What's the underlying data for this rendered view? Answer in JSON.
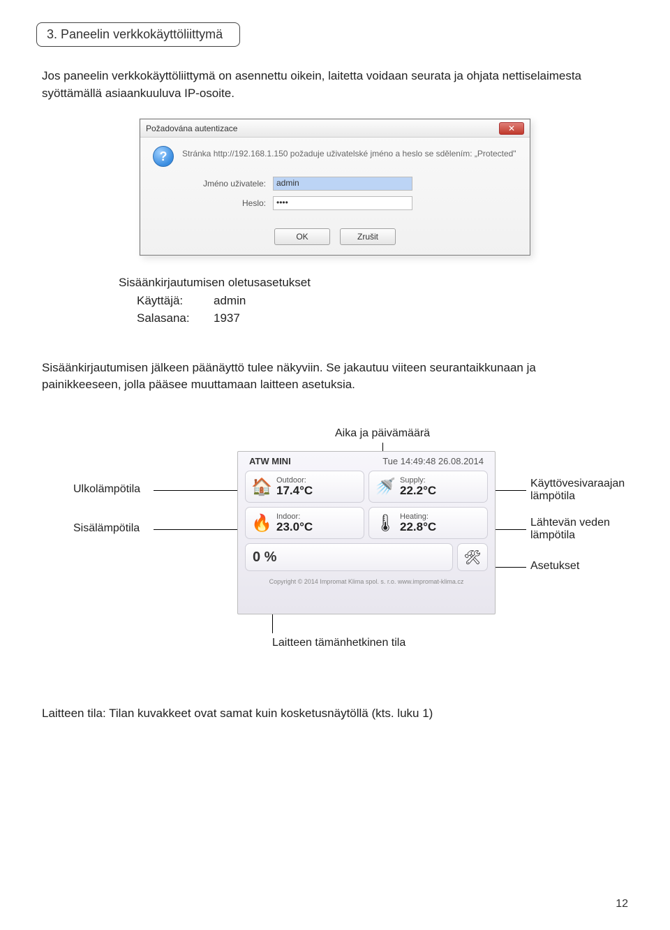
{
  "header": {
    "title": "3. Paneelin verkkokäyttöliittymä"
  },
  "intro": "Jos paneelin verkkokäyttöliittymä on asennettu oikein, laitetta voidaan seurata ja ohjata nettiselaimesta syöttämällä asiaankuuluva IP-osoite.",
  "auth": {
    "title": "Požadována autentizace",
    "message": "Stránka http://192.168.1.150 požaduje uživatelské jméno a heslo se sdělením: „Protected\"",
    "user_label": "Jméno uživatele:",
    "user_value": "admin",
    "pass_label": "Heslo:",
    "pass_value": "••••",
    "ok": "OK",
    "cancel": "Zrušit",
    "close": "✕"
  },
  "defaults": {
    "heading": "Sisäänkirjautumisen oletusasetukset",
    "user_k": "Käyttäjä:",
    "user_v": "admin",
    "pass_k": "Salasana:",
    "pass_v": "1937"
  },
  "para2": "Sisäänkirjautumisen jälkeen päänäyttö tulee näkyviin. Se jakautuu viiteen seurantaikkunaan ja painikkeeseen, jolla pääsee muuttamaan laitteen asetuksia.",
  "diagram": {
    "time_label": "Aika ja päivämäärä",
    "panel_name": "ATW MINI",
    "panel_time": "Tue 14:49:48 26.08.2014",
    "tiles": {
      "outdoor": {
        "cap": "Outdoor:",
        "val": "17.4°C",
        "icon": "🏠"
      },
      "supply": {
        "cap": "Supply:",
        "val": "22.2°C",
        "icon": "🚿"
      },
      "indoor": {
        "cap": "Indoor:",
        "val": "23.0°C",
        "icon": "🔥"
      },
      "heating": {
        "cap": "Heating:",
        "val": "22.8°C",
        "icon": "🌡"
      }
    },
    "status": "0 %",
    "tools": "🛠",
    "copyright": "Copyright © 2014 Impromat Klima spol. s. r.o.  www.impromat-klima.cz",
    "ann_outdoor": "Ulkolämpötila",
    "ann_indoor": "Sisälämpötila",
    "ann_supply1": "Käyttövesivaraajan",
    "ann_supply2": "lämpötila",
    "ann_heating1": "Lähtevän veden",
    "ann_heating2": "lämpötila",
    "ann_settings": "Asetukset",
    "ann_status": "Laitteen tämänhetkinen tila"
  },
  "footer": "Laitteen tila: Tilan kuvakkeet ovat samat kuin kosketusnäytöllä (kts. luku 1)",
  "page": "12"
}
